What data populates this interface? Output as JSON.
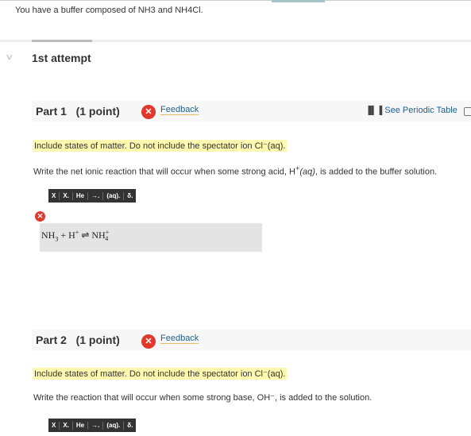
{
  "question": {
    "intro": "You have a buffer composed of NH3 and NH4Cl."
  },
  "attempt_label": "1st attempt",
  "parts": [
    {
      "title": "Part 1   (1 point)",
      "feedback_label": "Feedback",
      "periodic_table_label": "See Periodic Table",
      "hint": "Include states of matter. Do not include the spectator ion Cl⁻(aq).",
      "instruction_before": "Write the net ionic reaction that will occur when some strong acid, H",
      "instruction_sup": "+",
      "instruction_aq": "(aq)",
      "instruction_after": ", is added to the buffer solution.",
      "toolbar": [
        "X",
        "X.",
        "He",
        "→.",
        "(aq).",
        "δ."
      ],
      "answer": {
        "term1": "NH",
        "term1_sub": "3",
        "plus": "+",
        "term2": "H",
        "term2_sup": "+",
        "arrow": "⇌",
        "product": "NH",
        "product_sup": "+",
        "product_sub": "4"
      }
    },
    {
      "title": "Part 2   (1 point)",
      "feedback_label": "Feedback",
      "hint": "Include states of matter. Do not include the spectator ion Cl⁻(aq).",
      "instruction": "Write the reaction that will occur when some strong base, OH⁻, is added to the solution.",
      "toolbar": [
        "X",
        "X.",
        "He",
        "→.",
        "(aq).",
        "δ."
      ]
    }
  ],
  "colors": {
    "error_red": "#e0392b",
    "link_blue": "#1f5f8b",
    "highlight_yellow": "#fff9b0",
    "toolbar_dark": "#333333"
  }
}
